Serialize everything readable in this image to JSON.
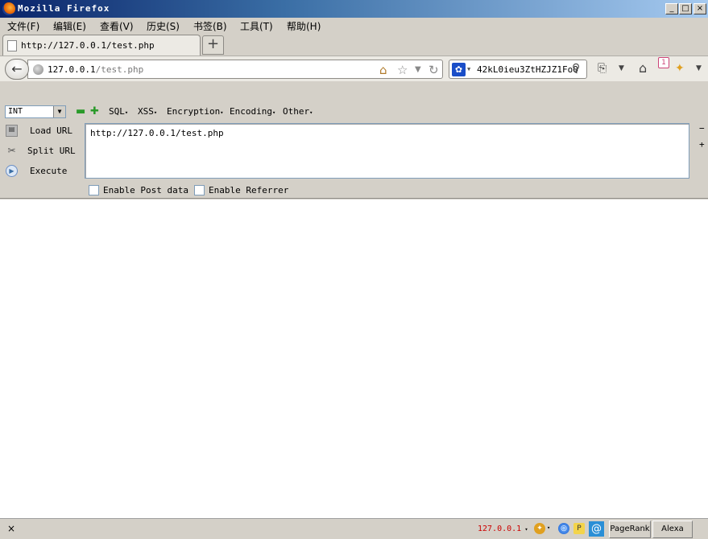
{
  "window": {
    "title": "Mozilla Firefox"
  },
  "menubar": [
    "文件(F)",
    "编辑(E)",
    "查看(V)",
    "历史(S)",
    "书签(B)",
    "工具(T)",
    "帮助(H)"
  ],
  "tab": {
    "title": "http://127.0.0.1/test.php",
    "new_tab": "+"
  },
  "nav": {
    "url_host": "127.0.0.1",
    "url_path": "/test.php",
    "search_text": "42kL0ieu3ZtHZJZ1FoQ",
    "badge": "1"
  },
  "hackbar": {
    "select_value": "INT",
    "menus": [
      "SQL",
      "XSS",
      "Encryption",
      "Encoding",
      "Other"
    ],
    "load_url": "Load URL",
    "split_url": "Split URL",
    "execute": "Execute",
    "url_value": "http://127.0.0.1/test.php",
    "post_label": "Enable Post data",
    "referrer_label": "Enable Referrer",
    "minus": "−",
    "plus": "+"
  },
  "statusbar": {
    "close": "×",
    "ip": "127.0.0.1",
    "pagerank": "PageRank",
    "alexa": "Alexa"
  },
  "colors": {
    "ip_text": "#cc0000",
    "title_gradient_start": "#0a246a"
  }
}
